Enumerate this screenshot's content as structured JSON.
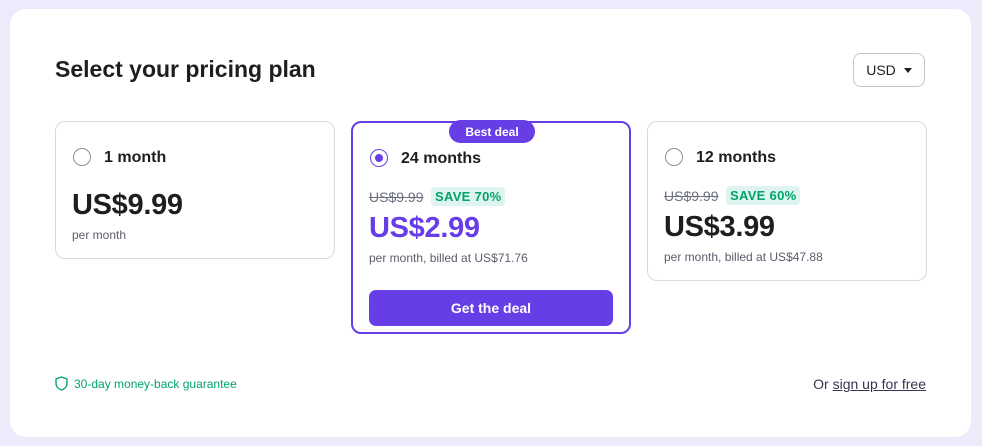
{
  "header": {
    "title": "Select your pricing plan",
    "currency": "USD"
  },
  "plans": [
    {
      "name": "1 month",
      "price": "US$9.99",
      "note": "per month",
      "selected": false
    },
    {
      "name": "24 months",
      "badge": "Best deal",
      "old_price": "US$9.99",
      "save": "SAVE 70%",
      "price": "US$2.99",
      "note": "per month, billed at US$71.76",
      "cta": "Get the deal",
      "selected": true
    },
    {
      "name": "12 months",
      "old_price": "US$9.99",
      "save": "SAVE 60%",
      "price": "US$3.99",
      "note": "per month, billed at US$47.88",
      "selected": false
    }
  ],
  "footer": {
    "guarantee": "30-day money-back guarantee",
    "signup_prefix": "Or",
    "signup_link": "sign up for free"
  },
  "colors": {
    "accent": "#673de6",
    "success": "#00a466",
    "success_bg": "#def4f0"
  }
}
